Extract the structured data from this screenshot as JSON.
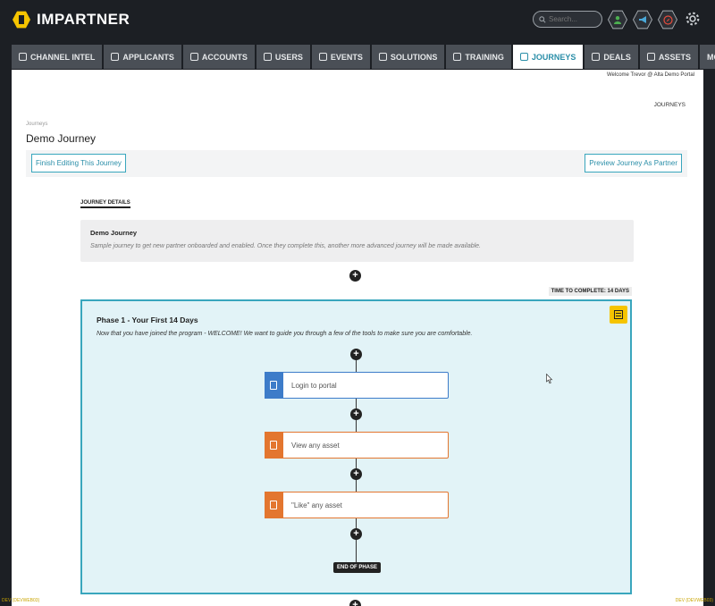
{
  "header": {
    "logo_text": "IMPARTNER",
    "search_placeholder": "Search..."
  },
  "nav": [
    {
      "label": "CHANNEL INTEL"
    },
    {
      "label": "APPLICANTS"
    },
    {
      "label": "ACCOUNTS"
    },
    {
      "label": "USERS"
    },
    {
      "label": "EVENTS"
    },
    {
      "label": "SOLUTIONS"
    },
    {
      "label": "TRAINING"
    },
    {
      "label": "JOURNEYS",
      "active": true
    },
    {
      "label": "DEALS"
    },
    {
      "label": "ASSETS"
    },
    {
      "label": "MORE"
    }
  ],
  "page": {
    "welcome": "Welcome Trevor @ Alta Demo Portal",
    "breadcrumb_right": "JOURNEYS",
    "breadcrumb_left": "Journeys",
    "title": "Demo Journey",
    "finish_button": "Finish Editing This Journey",
    "preview_button": "Preview Journey As Partner",
    "section_tag": "JOURNEY DETAILS",
    "journey_name": "Demo Journey",
    "journey_desc": "Sample journey to get new partner onboarded and enabled. Once they complete this, another more advanced journey will be made available.",
    "time_to_complete": "TIME TO COMPLETE: 14 DAYS"
  },
  "phase": {
    "title": "Phase 1 - Your First 14 Days",
    "subtitle": "Now that you have joined the program - WELCOME! We want to guide you through a few of the tools to make sure you are comfortable.",
    "steps": [
      {
        "label": "Login to portal",
        "color": "#3d7cc9"
      },
      {
        "label": "View any asset",
        "color": "#e3762f"
      },
      {
        "label": "\"Like\" any asset",
        "color": "#e3762f"
      }
    ],
    "end_label": "END OF PHASE"
  },
  "footer": {
    "dev_left": "DEV (DEVWEB03)",
    "dev_right": "DEV (DEVWEB03)"
  },
  "colors": {
    "accent": "#39a6bd",
    "brand_yellow": "#f5c400",
    "orange": "#e3762f",
    "blue": "#3d7cc9"
  }
}
